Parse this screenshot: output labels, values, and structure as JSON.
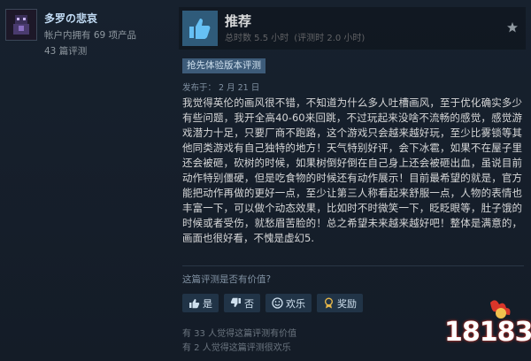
{
  "author": {
    "name": "多罗の悲哀",
    "products_owned": "帐户内拥有 69 项产品",
    "reviews_count": "43 篇评测"
  },
  "review": {
    "verdict": "推荐",
    "hours_total": "总时数 5.5 小时",
    "hours_at_review": "(评测时 2.0 小时)",
    "badge": "抢先体验版本评测",
    "posted": "发布于： 2 月 21 日",
    "body": "我觉得英伦的画风很不错，不知道为什么多人吐槽画风，至于优化确实多少有些问题，我开全高40-60来回跳，不过玩起来没啥不流畅的感觉，感觉游戏潜力十足，只要厂商不跑路，这个游戏只会越来越好玩，至少比雾锁等其他同类游戏有自己独特的地方！天气特别好评，会下冰雹，如果不在屋子里还会被砸，砍树的时候，如果树倒好倒在自己身上还会被砸出血，虽说目前动作特别僵硬，但是吃食物的时候还有动作展示！目前最希望的就是，官方能把动作再做的更好一点，至少让第三人称看起来舒服一点，人物的表情也丰富一下，可以做个动态效果，比如时不时微笑一下，眨眨眼等，肚子饿的时候或者受伤，就愁眉苦脸的！总之希望未来越来越好吧！整体是满意的，画面也很好看，不愧是虚幻5."
  },
  "helpful": {
    "question": "这篇评测是否有价值?",
    "buttons": {
      "yes": "是",
      "no": "否",
      "funny": "欢乐",
      "award": "奖励"
    },
    "stat_helpful": "有 33 人觉得这篇评测有价值",
    "stat_funny": "有 2 人觉得这篇评测很欢乐"
  },
  "watermark": {
    "text": "18183"
  },
  "colors": {
    "accent": "#66c0f4",
    "badge_bg": "#3d5b79",
    "thumb_bg": "#2f5b7a"
  }
}
